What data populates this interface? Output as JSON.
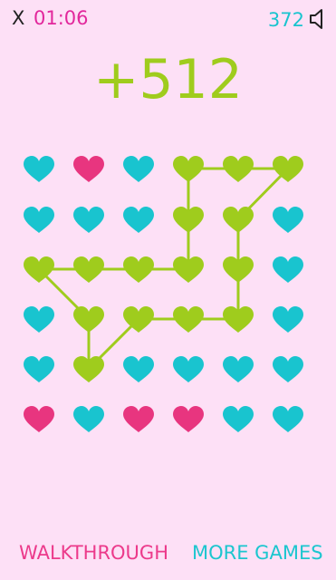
{
  "header": {
    "close_label": "X",
    "timer": "01:06",
    "score": "372",
    "sound_icon": "speaker-icon"
  },
  "bonus": "+512",
  "colors": {
    "background": "#fde0f6",
    "cyan": "#19c4cf",
    "pink": "#e8357f",
    "green": "#9fcc1d",
    "timer": "#e2279c",
    "walkthrough": "#ec3a8b",
    "more_games": "#1cc6cf"
  },
  "board": {
    "rows": 6,
    "cols": 6,
    "grid": [
      [
        "cyan",
        "pink",
        "cyan",
        "green",
        "green",
        "green"
      ],
      [
        "cyan",
        "cyan",
        "cyan",
        "green",
        "green",
        "cyan"
      ],
      [
        "green",
        "green",
        "green",
        "green",
        "green",
        "cyan"
      ],
      [
        "cyan",
        "green",
        "green",
        "green",
        "green",
        "cyan"
      ],
      [
        "cyan",
        "green",
        "cyan",
        "cyan",
        "cyan",
        "cyan"
      ],
      [
        "pink",
        "cyan",
        "pink",
        "pink",
        "cyan",
        "cyan"
      ]
    ],
    "path": [
      [
        0,
        5
      ],
      [
        1,
        4
      ],
      [
        2,
        4
      ],
      [
        3,
        4
      ],
      [
        3,
        3
      ],
      [
        3,
        2
      ],
      [
        4,
        1
      ],
      [
        3,
        1
      ],
      [
        2,
        0
      ],
      [
        2,
        1
      ],
      [
        2,
        2
      ],
      [
        2,
        3
      ],
      [
        1,
        3
      ],
      [
        0,
        3
      ],
      [
        0,
        4
      ],
      [
        0,
        5
      ]
    ]
  },
  "footer": {
    "walkthrough": "WALKTHROUGH",
    "more_games": "MORE GAMES"
  }
}
